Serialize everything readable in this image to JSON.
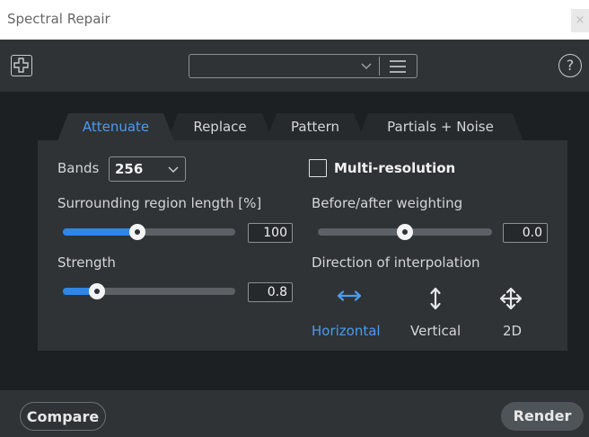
{
  "window": {
    "title": "Spectral Repair",
    "close_glyph": "×"
  },
  "toolbar": {
    "add_icon": "plus-square-icon",
    "preset_value": "",
    "preset_menu_icon": "hamburger-menu-icon",
    "help_glyph": "?"
  },
  "tabs": [
    {
      "label": "Attenuate",
      "active": true
    },
    {
      "label": "Replace",
      "active": false
    },
    {
      "label": "Pattern",
      "active": false
    },
    {
      "label": "Partials + Noise",
      "active": false
    }
  ],
  "attenuate": {
    "bands_label": "Bands",
    "bands_value": "256",
    "multires_label": "Multi-resolution",
    "multires_checked": false,
    "surrounding_label": "Surrounding region length [%]",
    "surrounding_value": "100",
    "surrounding_fraction": 0.43,
    "weighting_label": "Before/after weighting",
    "weighting_value": "0.0",
    "weighting_fraction": 0.5,
    "strength_label": "Strength",
    "strength_value": "0.8",
    "strength_fraction": 0.2,
    "direction_label": "Direction of interpolation",
    "directions": [
      {
        "label": "Horizontal",
        "icon": "horizontal-arrows-icon",
        "active": true
      },
      {
        "label": "Vertical",
        "icon": "vertical-arrows-icon",
        "active": false
      },
      {
        "label": "2D",
        "icon": "four-way-arrows-icon",
        "active": false
      }
    ]
  },
  "footer": {
    "compare_label": "Compare",
    "render_label": "Render"
  },
  "colors": {
    "accent": "#4c9bf0",
    "slider_fill": "#2e86e8",
    "panel": "#2f3336",
    "background": "#1c2023"
  }
}
